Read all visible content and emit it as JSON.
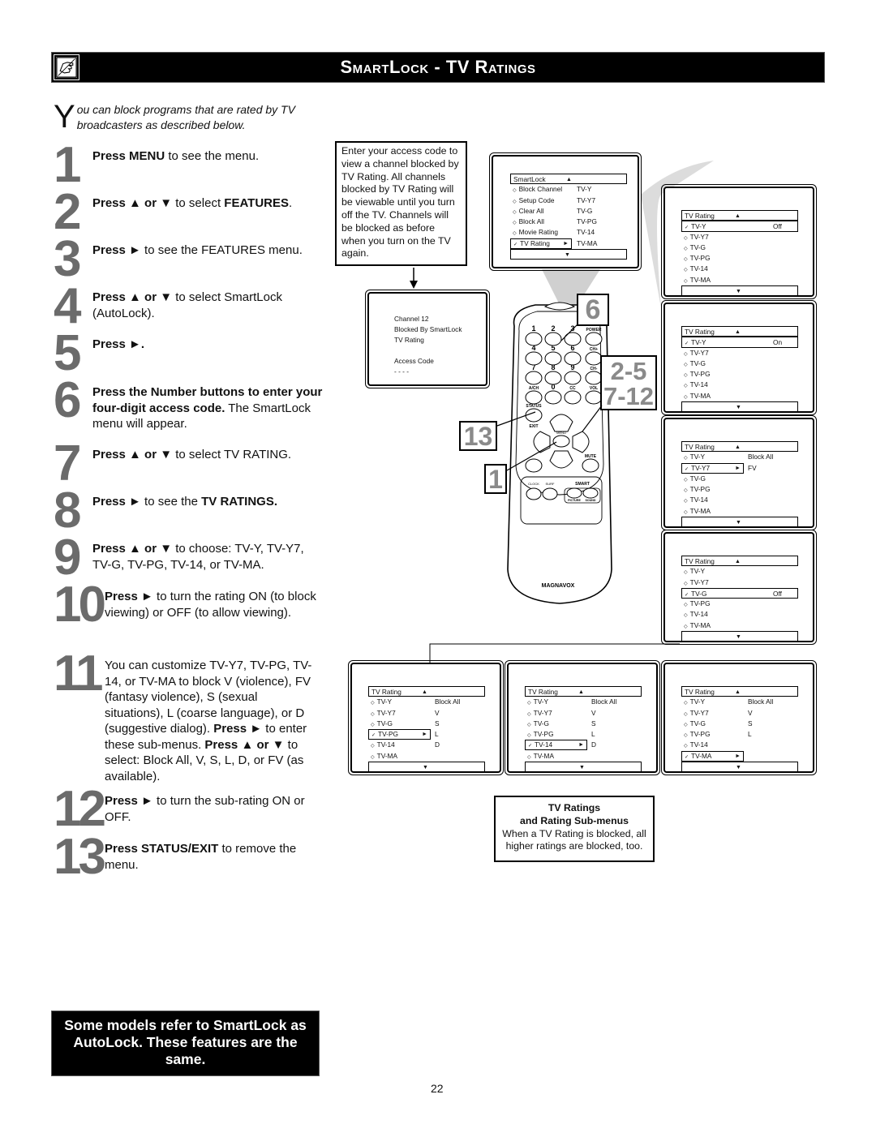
{
  "header": {
    "title": "SmartLock - TV Ratings",
    "icon": "pointing-hand-icon"
  },
  "intro": {
    "dropcap": "Y",
    "text": "ou can block programs that are rated by TV broadcasters as described below."
  },
  "steps": [
    {
      "num": "1",
      "parts": [
        {
          "b": "Press MENU"
        },
        {
          "t": " to see the menu."
        }
      ]
    },
    {
      "num": "2",
      "parts": [
        {
          "b": "Press ▲ or ▼"
        },
        {
          "t": " to select "
        },
        {
          "b": "FEATURES"
        },
        {
          "t": "."
        }
      ]
    },
    {
      "num": "3",
      "parts": [
        {
          "b": "Press ►"
        },
        {
          "t": " to see the FEATURES menu."
        }
      ]
    },
    {
      "num": "4",
      "parts": [
        {
          "b": "Press ▲ or ▼"
        },
        {
          "t": " to select SmartLock (AutoLock)."
        }
      ]
    },
    {
      "num": "5",
      "parts": [
        {
          "b": "Press ►."
        }
      ]
    },
    {
      "num": "6",
      "parts": [
        {
          "b": "Press the Number buttons to enter your four-digit access code."
        },
        {
          "t": " The SmartLock menu will appear."
        }
      ]
    },
    {
      "num": "7",
      "parts": [
        {
          "b": "Press ▲ or ▼"
        },
        {
          "t": " to select TV RATING."
        }
      ]
    },
    {
      "num": "8",
      "parts": [
        {
          "b": "Press ►"
        },
        {
          "t": " to see the "
        },
        {
          "b": "TV RATINGS."
        }
      ]
    },
    {
      "num": "9",
      "parts": [
        {
          "b": "Press ▲ or ▼"
        },
        {
          "t": " to choose: TV-Y, TV-Y7, TV-G, TV-PG, TV-14, or TV-MA."
        }
      ]
    },
    {
      "num": "10",
      "parts": [
        {
          "b": "Press ►"
        },
        {
          "t": " to turn the rating ON (to block viewing) or OFF (to allow viewing)."
        }
      ]
    },
    {
      "num": "11",
      "parts": [
        {
          "t": "You can customize TV-Y7, TV-PG, TV-14, or TV-MA to block V (violence), FV (fantasy violence), S (sexual situations), L (coarse language), or D (suggestive dialog). "
        },
        {
          "b": "Press ►"
        },
        {
          "t": " to enter these sub-menus. "
        },
        {
          "b": "Press ▲ or ▼"
        },
        {
          "t": " to select: Block All, V, S, L, D, or FV (as available)."
        }
      ]
    },
    {
      "num": "12",
      "parts": [
        {
          "b": "Press ►"
        },
        {
          "t": " to turn the sub-rating ON or OFF."
        }
      ]
    },
    {
      "num": "13",
      "parts": [
        {
          "b": "Press STATUS/EXIT"
        },
        {
          "t": " to remove the menu."
        }
      ]
    }
  ],
  "callout": "Enter your access code to view a channel blocked by TV Rating. All channels blocked by TV Rating will be viewable until you turn off the TV. Channels will be blocked as before when you turn on the TV again.",
  "blocked_screen": {
    "lines": [
      "Channel 12",
      "Blocked By SmartLock",
      "TV Rating",
      "",
      "Access Code",
      "- - - -"
    ]
  },
  "smartlock_menu": {
    "title": "SmartLock",
    "items": [
      {
        "label": "Block Channel",
        "marker": "◇",
        "value": "TV-Y"
      },
      {
        "label": "Setup Code",
        "marker": "◇",
        "value": "TV-Y7"
      },
      {
        "label": "Clear All",
        "marker": "◇",
        "value": "TV-G"
      },
      {
        "label": "Block All",
        "marker": "◇",
        "value": "TV-PG"
      },
      {
        "label": "Movie Rating",
        "marker": "◇",
        "value": "TV-14"
      },
      {
        "label": "TV Rating",
        "marker": "✓",
        "value": "TV-MA",
        "selected": true
      }
    ]
  },
  "rating_screens": [
    {
      "title": "TV Rating",
      "selected": 0,
      "arrow": false,
      "values": [
        "Off",
        "",
        "",
        "",
        "",
        ""
      ]
    },
    {
      "title": "TV Rating",
      "selected": 0,
      "arrow": false,
      "values": [
        "On",
        "",
        "",
        "",
        "",
        ""
      ]
    },
    {
      "title": "TV Rating",
      "selected": 1,
      "arrow": true,
      "values": [
        "Block All",
        "FV",
        "",
        "",
        "",
        ""
      ]
    },
    {
      "title": "TV Rating",
      "selected": 2,
      "arrow": false,
      "values": [
        "",
        "",
        "Off",
        "",
        "",
        ""
      ]
    },
    {
      "title": "TV Rating",
      "selected": 3,
      "arrow": true,
      "values": [
        "Block All",
        "V",
        "S",
        "L",
        "D",
        ""
      ]
    },
    {
      "title": "TV Rating",
      "selected": 4,
      "arrow": true,
      "values": [
        "Block All",
        "V",
        "S",
        "L",
        "D",
        ""
      ]
    },
    {
      "title": "TV Rating",
      "selected": 5,
      "arrow": true,
      "values": [
        "Block All",
        "V",
        "S",
        "L",
        "",
        ""
      ]
    }
  ],
  "ratings": [
    "TV-Y",
    "TV-Y7",
    "TV-G",
    "TV-PG",
    "TV-14",
    "TV-MA"
  ],
  "remote": {
    "brand": "MAGNAVOX",
    "buttons": [
      "1",
      "2",
      "3",
      "POWER",
      "4",
      "5",
      "6",
      "CH+",
      "7",
      "8",
      "9",
      "CH-",
      "A/CH",
      "0",
      "CC",
      "VOL",
      "STATUS",
      "EXIT",
      "MENU",
      "MUTE",
      "CLOCK",
      "SURF",
      "SMART",
      "PICTURE",
      "SOUND"
    ]
  },
  "remote_callouts": {
    "six": "6",
    "range": [
      "2-5",
      "7-12"
    ],
    "thirteen": "13",
    "one": "1"
  },
  "info_box": {
    "title1": "TV Ratings",
    "title2": "and Rating Sub-menus",
    "body": "When a TV Rating is blocked, all higher ratings are blocked, too."
  },
  "note": "Some models refer to SmartLock as AutoLock. These features are the same.",
  "page_number": "22"
}
